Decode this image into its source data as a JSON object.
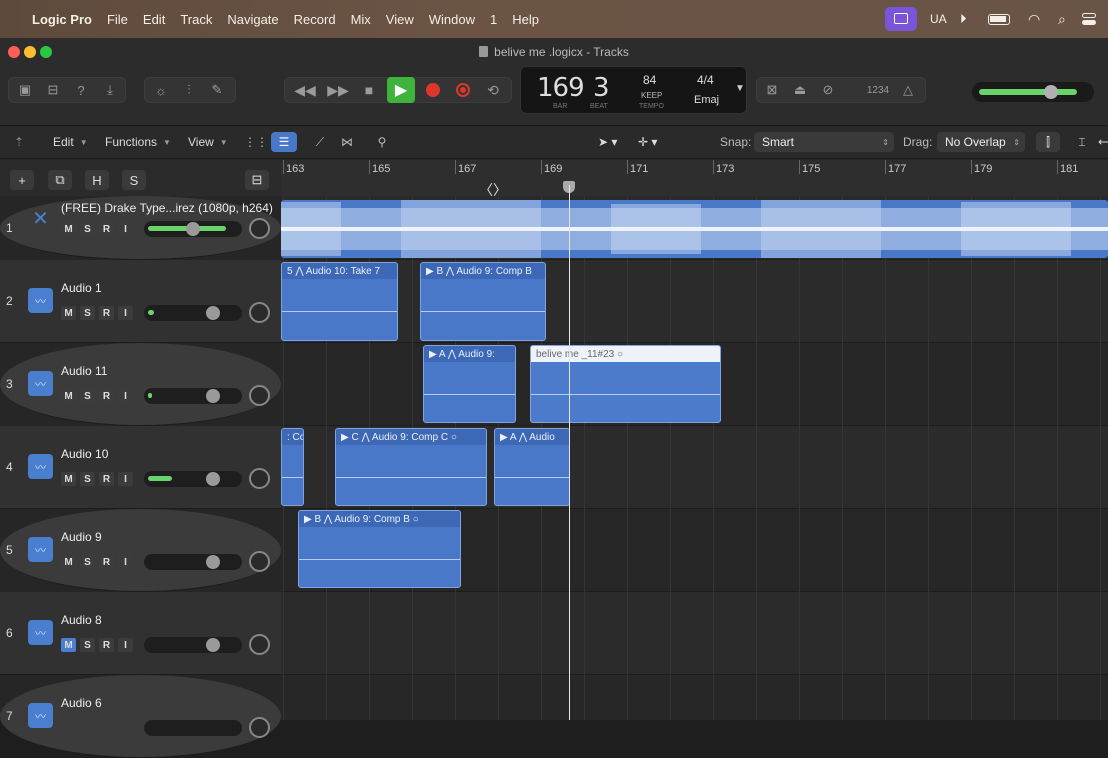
{
  "menubar": {
    "app": "Logic Pro",
    "items": [
      "File",
      "Edit",
      "Track",
      "Navigate",
      "Record",
      "Mix",
      "View",
      "Window",
      "1",
      "Help"
    ],
    "input_source": "UA"
  },
  "window": {
    "title": "belive me .logicx - Tracks"
  },
  "lcd": {
    "bar": "169",
    "beat": "3",
    "bar_label": "BAR",
    "beat_label": "BEAT",
    "tempo": "84",
    "tempo_mode": "KEEP",
    "tempo_label": "TEMPO",
    "time_signature": "4/4",
    "key": "Emaj"
  },
  "toolbar": {
    "count_in_label": "1234"
  },
  "subtoolbar": {
    "edit": "Edit",
    "functions": "Functions",
    "view": "View",
    "snap_label": "Snap:",
    "snap_value": "Smart",
    "drag_label": "Drag:",
    "drag_value": "No Overlap"
  },
  "track_header_buttons": [
    "+",
    "H",
    "S"
  ],
  "ruler": {
    "bars": [
      "163",
      "165",
      "167",
      "169",
      "171",
      "173",
      "175",
      "177",
      "179",
      "181"
    ]
  },
  "tracks": [
    {
      "num": "1",
      "name": "(FREE) Drake Type...irez (1080p, h264)",
      "type": "video",
      "msri": [
        "M",
        "S",
        "R",
        "I"
      ],
      "meter_fraction": 0.8
    },
    {
      "num": "2",
      "name": "Audio 1",
      "type": "audio",
      "msri": [
        "M",
        "S",
        "R",
        "I"
      ],
      "meter_fraction": 0.2
    },
    {
      "num": "3",
      "name": "Audio 11",
      "type": "audio",
      "msri": [
        "M",
        "S",
        "R",
        "I"
      ],
      "meter_fraction": 0.1
    },
    {
      "num": "4",
      "name": "Audio 10",
      "type": "audio",
      "msri": [
        "M",
        "S",
        "R",
        "I"
      ],
      "meter_fraction": 0.4
    },
    {
      "num": "5",
      "name": "Audio 9",
      "type": "audio",
      "msri": [
        "M",
        "S",
        "R",
        "I"
      ],
      "meter_fraction": 0
    },
    {
      "num": "6",
      "name": "Audio 8",
      "type": "audio",
      "msri": [
        "M",
        "S",
        "R",
        "I"
      ],
      "meter_fraction": 0
    },
    {
      "num": "7",
      "name": "Audio 6",
      "type": "audio",
      "msri": [
        "M",
        "S",
        "R",
        "I"
      ],
      "meter_fraction": 0
    }
  ],
  "regions": {
    "r2a": "5  ⋀ Audio 10: Take 7",
    "r2b": "▶  B  ⋀ Audio 9: Comp B",
    "r3a": "▶  A  ⋀ Audio 9:",
    "r3b": "belive me _11#23  ○",
    "r4a": ": Co",
    "r4b": "▶  C  ⋀ Audio 9: Comp C  ○",
    "r4c": "▶  A  ⋀ Audio",
    "r5a": "▶  B  ⋀ Audio 9: Comp B  ○"
  },
  "colors": {
    "region_blue": "#4a78c8",
    "record_red": "#e0352b",
    "play_green": "#3fb43c",
    "meter_green": "#6ad36a"
  }
}
